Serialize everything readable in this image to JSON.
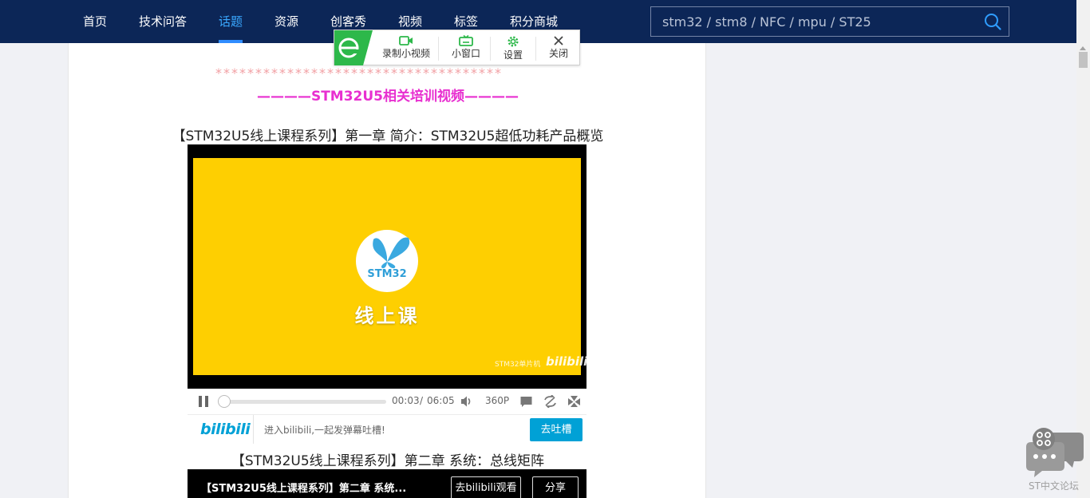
{
  "nav": {
    "items": [
      "首页",
      "技术问答",
      "话题",
      "资源",
      "创客秀",
      "视频",
      "标签",
      "积分商城"
    ],
    "active_index": 2,
    "search_placeholder": "stm32 / stm8 / NFC / mpu / ST25"
  },
  "popup": {
    "record_label": "录制小视频",
    "mini_label": "小窗口",
    "settings_label": "设置",
    "close_label": "关闭"
  },
  "article": {
    "stars": "************************************",
    "section_title": "————STM32U5相关培训视频————",
    "video1_title": "【STM32U5线上课程系列】第一章 简介：STM32U5超低功耗产品概览",
    "video2_title": "【STM32U5线上课程系列】第二章 系统：总线矩阵"
  },
  "player": {
    "logo_text": "STM32",
    "course_text": "线上课",
    "watermark_text": "STM32单片机",
    "watermark_logo": "bilibili",
    "current_time": "00:03",
    "time_separator": "/",
    "duration": "06:05",
    "progress_fraction": 0.008,
    "quality": "360P",
    "bili_logo": "bilibili",
    "danmu_placeholder": "进入bilibili,一起发弹幕吐槽!",
    "danmu_button": "去吐槽"
  },
  "player2": {
    "title": "【STM32U5线上课程系列】第二章 系统...",
    "watch_button": "去bilibili观看",
    "share_button": "分享"
  },
  "chat_widget": {
    "label": "ST中文论坛"
  },
  "colors": {
    "nav_bg": "#0c2657",
    "nav_active": "#3aa8ff",
    "subtitle": "#e82fd0",
    "bili_blue": "#00a1d6",
    "thumb_yellow": "#fecf01"
  }
}
